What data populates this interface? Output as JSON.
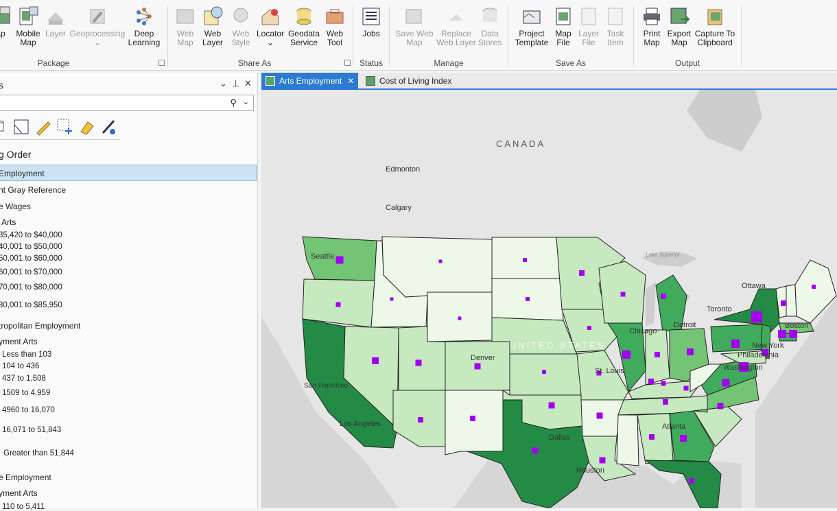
{
  "ribbon": {
    "tools": [
      {
        "label": "ap",
        "enabled": true
      },
      {
        "label": "Mobile Map",
        "enabled": true
      },
      {
        "label": "Layer",
        "enabled": false
      },
      {
        "label": "Geoprocessing",
        "enabled": false
      },
      {
        "label": "Deep Learning",
        "enabled": true
      },
      {
        "label": "Web Map",
        "enabled": false
      },
      {
        "label": "Web Layer",
        "enabled": true
      },
      {
        "label": "Web Style",
        "enabled": false
      },
      {
        "label": "Locator",
        "enabled": true
      },
      {
        "label": "Geodata Service",
        "enabled": true
      },
      {
        "label": "Web Tool",
        "enabled": true
      },
      {
        "label": "Jobs",
        "enabled": true
      },
      {
        "label": "Save Web Map",
        "enabled": false
      },
      {
        "label": "Replace Web Layer",
        "enabled": false
      },
      {
        "label": "Data Stores",
        "enabled": false
      },
      {
        "label": "Project Template",
        "enabled": true
      },
      {
        "label": "Map File",
        "enabled": true
      },
      {
        "label": "Layer File",
        "enabled": false
      },
      {
        "label": "Task Item",
        "enabled": false
      },
      {
        "label": "Print Map",
        "enabled": true
      },
      {
        "label": "Export Map",
        "enabled": true
      },
      {
        "label": "Capture To Clipboard",
        "enabled": true
      }
    ],
    "groups": [
      "Package",
      "Share As",
      "Status",
      "Manage",
      "Save As",
      "Output"
    ]
  },
  "pane": {
    "title": "s",
    "search_value": "",
    "heading": "g Order",
    "rows": [
      "Employment",
      "nt Gray Reference",
      "e Wages",
      "Arts",
      "35,420 to $40,000",
      "40,001 to $50,000",
      "50,001 to $60,000",
      "60,001 to $70,000",
      "70,001 to $80,000",
      "80,001 to $85,950",
      "tropolitan Employment",
      "yment Arts",
      "Less than 103",
      "104 to 436",
      "437 to 1,508",
      "1509 to 4,959",
      "4960 to 16,070",
      "16,071 to 51,843",
      "Greater than 51,844",
      "e Employment",
      "yment Arts",
      "110 to 5,411"
    ]
  },
  "tabs": [
    "Arts Employment",
    "Cost of Living Index"
  ],
  "map": {
    "labels": [
      "CANADA",
      "Edmonton",
      "Calgary",
      "Ottawa",
      "Toronto",
      "Detroit",
      "Chicago",
      "Boston",
      "New York",
      "Philadelphia",
      "Washington",
      "St. Louis",
      "Denver",
      "San Francisco",
      "Los Angeles",
      "Dallas",
      "Houston",
      "Atlanta",
      "Seattle",
      "UNITED STATES",
      "Lake Superior"
    ],
    "colors": {
      "c1": "#edf8e9",
      "c2": "#c7e9c0",
      "c3": "#a1d99b",
      "c4": "#74c476",
      "c5": "#41ab5d",
      "c6": "#238b45",
      "symbol": "#a500f2",
      "land": "#e6e6e6",
      "water": "#c9c9c9"
    }
  }
}
